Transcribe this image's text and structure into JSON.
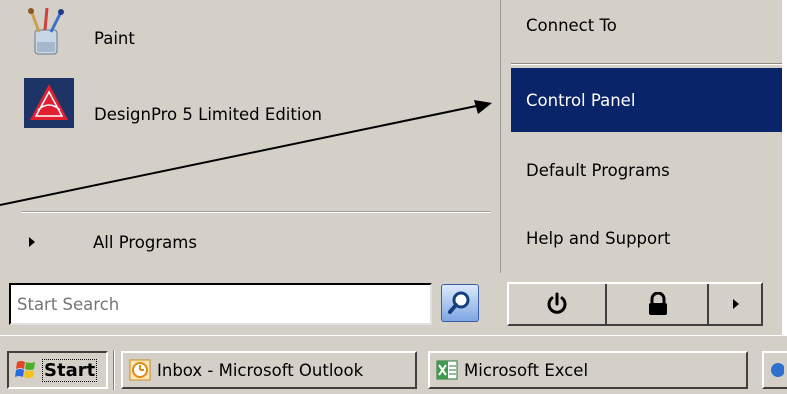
{
  "start_menu": {
    "left_panel": {
      "programs": [
        {
          "label": "Paint",
          "icon": "paint-icon"
        },
        {
          "label": "DesignPro 5 Limited Edition",
          "icon": "designpro-icon"
        }
      ],
      "all_programs_label": "All Programs"
    },
    "right_panel": {
      "items": [
        {
          "label": "Connect To"
        },
        {
          "label": "Control Panel",
          "selected": true
        },
        {
          "label": "Default Programs"
        },
        {
          "label": "Help and Support"
        }
      ]
    },
    "search": {
      "placeholder": "Start Search",
      "value": ""
    },
    "buttons": {
      "search_icon": "magnifier-icon",
      "power_icon": "power-icon",
      "lock_icon": "lock-icon",
      "more_icon": "arrow-right-icon"
    }
  },
  "taskbar": {
    "start_label": "Start",
    "tasks": [
      {
        "label": "Inbox - Microsoft Outlook",
        "icon": "outlook-icon"
      },
      {
        "label": "Microsoft Excel",
        "icon": "excel-icon"
      }
    ]
  },
  "colors": {
    "menu_bg": "#d4d0c8",
    "selection": "#0a246a",
    "selection_text": "#ffffff"
  }
}
